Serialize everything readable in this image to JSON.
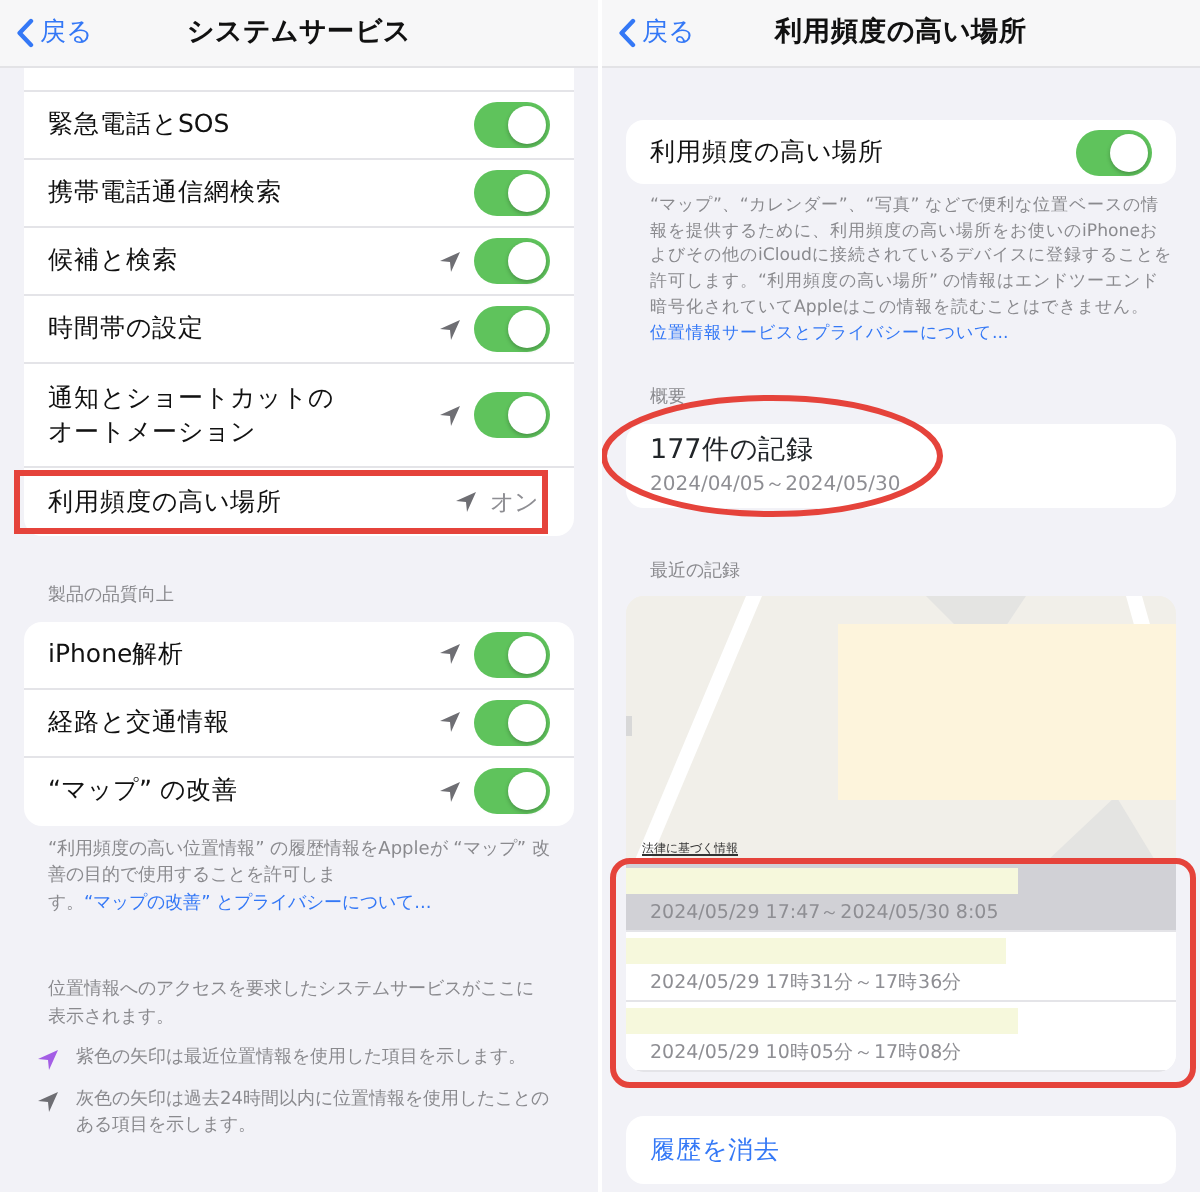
{
  "left_screen": {
    "back": "戻る",
    "title": "システムサービス",
    "rows": [
      {
        "kind": "toggle",
        "label": "緊急電話とSOS",
        "location_arrow": false,
        "on": true,
        "highlighted": false
      },
      {
        "kind": "toggle",
        "label": "携帯電話通信網検索",
        "location_arrow": false,
        "on": true,
        "highlighted": false
      },
      {
        "kind": "toggle",
        "label": "候補と検索",
        "location_arrow": true,
        "on": true,
        "highlighted": false
      },
      {
        "kind": "toggle",
        "label": "時間帯の設定",
        "location_arrow": true,
        "on": true,
        "highlighted": false
      },
      {
        "kind": "toggle",
        "label": "通知とショートカットのオートメーション",
        "location_arrow": true,
        "on": true,
        "highlighted": false
      },
      {
        "kind": "value",
        "label": "利用頻度の高い場所",
        "location_arrow": true,
        "value": "オン",
        "highlighted": true
      }
    ],
    "section_header": "製品の品質向上",
    "quality_rows": [
      {
        "kind": "toggle",
        "label": "iPhone解析",
        "location_arrow": true,
        "on": true,
        "highlighted": false
      },
      {
        "kind": "toggle",
        "label": "経路と交通情報",
        "location_arrow": true,
        "on": true,
        "highlighted": false
      },
      {
        "kind": "toggle",
        "label": "“マップ” の改善",
        "location_arrow": true,
        "on": true,
        "highlighted": false
      }
    ],
    "footer": {
      "text": "“利用頻度の高い位置情報” の履歴情報をAppleが “マップ” 改善の目的で使用することを許可します。",
      "link": "“マップの改善” とプライバシーについて..."
    },
    "access_note": "位置情報へのアクセスを要求したシステムサービスがここに表示されます。",
    "legend": [
      {
        "color": "#a45ee5",
        "text": "紫色の矢印は最近位置情報を使用した項目を示します。"
      },
      {
        "color": "#6e6e73",
        "text": "灰色の矢印は過去24時間以内に位置情報を使用したことのある項目を示します。"
      }
    ]
  },
  "right_screen": {
    "back": "戻る",
    "title": "利用頻度の高い場所",
    "toggle_row": {
      "label": "利用頻度の高い場所",
      "on": true
    },
    "description": {
      "text": "“マップ”、“カレンダー”、“写真” などで便利な位置ベースの情報を提供するために、利用頻度の高い場所をお使いのiPhoneおよびその他のiCloudに接続されているデバイスに登録することを許可します。“利用頻度の高い場所” の情報はエンドツーエンド暗号化されていてAppleはこの情報を読むことはできません。",
      "link": "位置情報サービスとプライバシーについて..."
    },
    "summary": {
      "header": "概要",
      "title": "177件の記録",
      "dates": "2024/04/05～2024/05/30",
      "highlighted": true
    },
    "recent": {
      "header": "最近の記録",
      "map_notice": "法律に基づく情報",
      "highlighted": true,
      "rows": [
        {
          "time": "2024/05/29 17:47～2024/05/30 8:05",
          "selected": true
        },
        {
          "time": "2024/05/29 17時31分～17時36分",
          "selected": false
        },
        {
          "time": "2024/05/29 10時05分～17時08分",
          "selected": false
        }
      ]
    },
    "clear_button": "履歴を消去"
  }
}
